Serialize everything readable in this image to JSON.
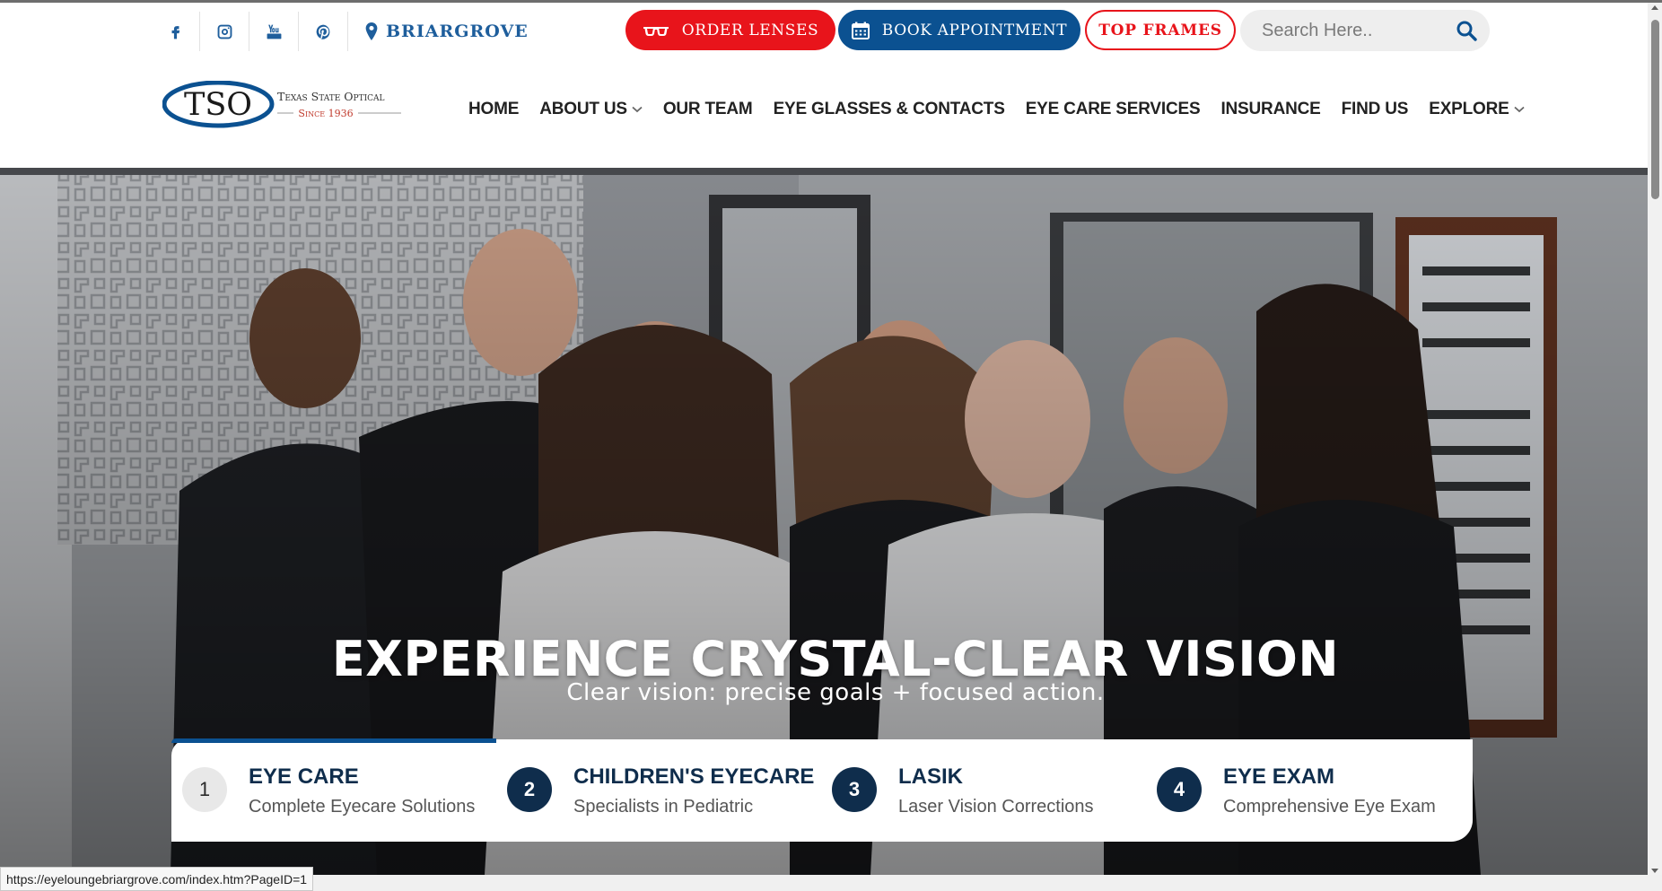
{
  "topbar": {
    "social_icons": [
      "facebook-icon",
      "instagram-icon",
      "youtube-icon",
      "pinterest-icon"
    ],
    "location_label": "BRIARGROVE",
    "order_lenses_label": "ORDER LENSES",
    "book_appointment_label": "BOOK APPOINTMENT",
    "top_frames_label": "TOP FRAMES",
    "search_placeholder": "Search Here.."
  },
  "logo": {
    "mark": "TSO",
    "name": "Texas State Optical",
    "tagline": "Since 1936"
  },
  "nav": {
    "items": [
      {
        "label": "HOME",
        "has_dropdown": false
      },
      {
        "label": "ABOUT US",
        "has_dropdown": true
      },
      {
        "label": "OUR TEAM",
        "has_dropdown": false
      },
      {
        "label": "EYE GLASSES & CONTACTS",
        "has_dropdown": false
      },
      {
        "label": "EYE CARE SERVICES",
        "has_dropdown": false
      },
      {
        "label": "INSURANCE",
        "has_dropdown": false
      },
      {
        "label": "FIND US",
        "has_dropdown": false
      },
      {
        "label": "EXPLORE",
        "has_dropdown": true
      }
    ]
  },
  "hero": {
    "title": "EXPERIENCE CRYSTAL-CLEAR VISION",
    "subtitle": "Clear vision: precise goals + focused action."
  },
  "services": [
    {
      "number": "1",
      "title": "EYE CARE",
      "description": "Complete Eyecare Solutions",
      "active": true
    },
    {
      "number": "2",
      "title": "CHILDREN'S EYECARE",
      "description": "Specialists in Pediatric",
      "active": false
    },
    {
      "number": "3",
      "title": "LASIK",
      "description": "Laser Vision Corrections",
      "active": false
    },
    {
      "number": "4",
      "title": "EYE EXAM",
      "description": "Comprehensive Eye Exam",
      "active": false
    }
  ],
  "status_url": "https://eyeloungebriargrove.com/index.htm?PageID=1",
  "colors": {
    "brand_blue": "#0b5191",
    "brand_red": "#e8141b",
    "navy": "#0f2d4c",
    "link_blue": "#1e5e9c"
  }
}
